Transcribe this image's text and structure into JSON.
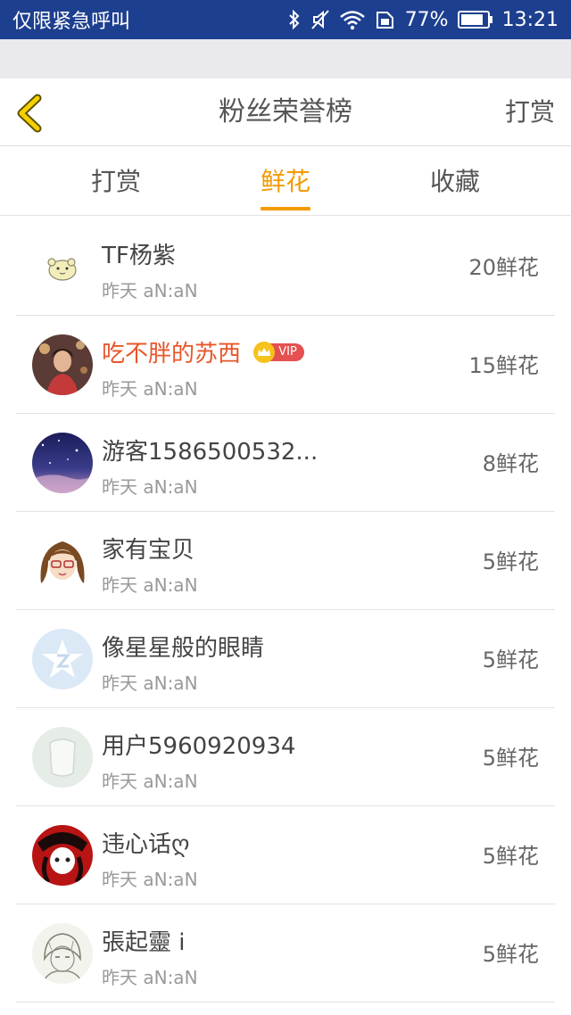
{
  "status_bar": {
    "carrier": "仅限紧急呼叫",
    "battery": "77%",
    "time": "13:21",
    "icons": [
      "bluetooth-icon",
      "silent-icon",
      "wifi-icon",
      "sim-icon",
      "battery-icon"
    ]
  },
  "header": {
    "title": "粉丝荣誉榜",
    "action": "打赏",
    "back_icon": "chevron-left-icon"
  },
  "tabs": [
    {
      "label": "打赏",
      "active": false
    },
    {
      "label": "鲜花",
      "active": true
    },
    {
      "label": "收藏",
      "active": false
    }
  ],
  "colors": {
    "status_bar": "#1d3f8f",
    "accent": "#f39a00",
    "vip_name": "#e8562a",
    "back_icon": "#f5d000"
  },
  "fans": [
    {
      "name": "TF杨紫",
      "time": "昨天 aN:aN",
      "count": "20鲜花",
      "avatar": "hamster-avatar"
    },
    {
      "name": "吃不胖的苏西",
      "time": "昨天 aN:aN",
      "count": "15鲜花",
      "avatar": "photo-avatar",
      "vip": "VIP"
    },
    {
      "name": "游客1586500532...",
      "time": "昨天 aN:aN",
      "count": "8鲜花",
      "avatar": "night-sky-avatar"
    },
    {
      "name": "家有宝贝",
      "time": "昨天 aN:aN",
      "count": "5鲜花",
      "avatar": "cartoon-girl-avatar"
    },
    {
      "name": "像星星般的眼睛",
      "time": "昨天 aN:aN",
      "count": "5鲜花",
      "avatar": "default-star-avatar"
    },
    {
      "name": "用户5960920934",
      "time": "昨天 aN:aN",
      "count": "5鲜花",
      "avatar": "default-blank-avatar"
    },
    {
      "name": "违心话ღ",
      "time": "昨天 aN:aN",
      "count": "5鲜花",
      "avatar": "anime-red-avatar"
    },
    {
      "name": "張起靈 i",
      "time": "昨天 aN:aN",
      "count": "5鲜花",
      "avatar": "sketch-avatar"
    }
  ]
}
